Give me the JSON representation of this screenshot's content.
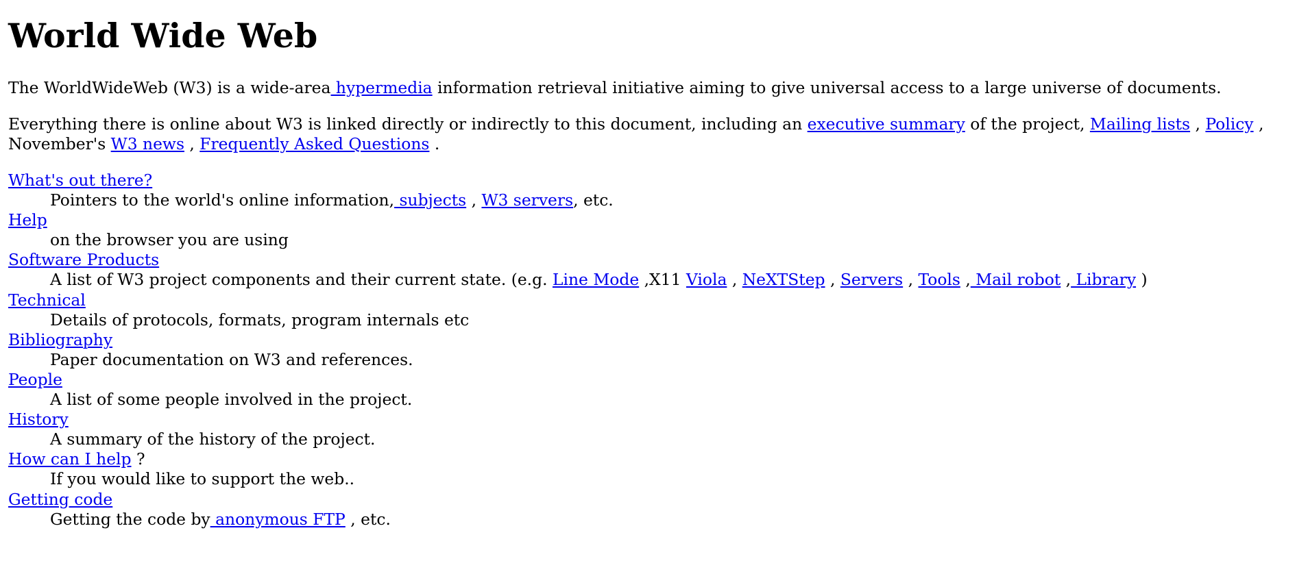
{
  "title": "World Wide Web",
  "intro": {
    "before": "The WorldWideWeb (W3) is a wide-area",
    "link": " hypermedia",
    "after": " information retrieval initiative aiming to give universal access to a large universe of documents."
  },
  "summary": {
    "line1_before": "Everything there is online about W3 is linked directly or indirectly to this document, including an ",
    "executive_summary": "executive summary",
    "mid": " of the project, ",
    "mailing_lists": "Mailing lists",
    "sep1": " , ",
    "policy": "Policy",
    "sep2": " ,",
    "line2_before": "November's ",
    "w3_news": "W3 news",
    "sep3": " , ",
    "faq": "Frequently Asked Questions",
    "end": " ."
  },
  "entries": {
    "whats_out": {
      "term": "What's out there?",
      "desc_before": "Pointers to the world's online information,",
      "subjects": " subjects",
      "sep": " , ",
      "servers": "W3 servers",
      "end": ", etc."
    },
    "help": {
      "term": "Help",
      "desc": "on the browser you are using"
    },
    "software": {
      "term": "Software Products",
      "desc_before": "A list of W3 project components and their current state. (e.g. ",
      "line_mode": "Line Mode",
      "x11": " ,X11 ",
      "viola": "Viola",
      "sep1": " , ",
      "nextstep": "NeXTStep",
      "sep2": " , ",
      "servers": "Servers",
      "sep3": " , ",
      "tools": "Tools",
      "sep4": " ,",
      "mail_robot": " Mail robot",
      "sep5": " ,",
      "library": " Library",
      "end": " )"
    },
    "technical": {
      "term": "Technical",
      "desc": "Details of protocols, formats, program internals etc"
    },
    "bibliography": {
      "term": "Bibliography",
      "desc": "Paper documentation on W3 and references."
    },
    "people": {
      "term": "People",
      "desc": "A list of some people involved in the project."
    },
    "history": {
      "term": "History",
      "desc": "A summary of the history of the project."
    },
    "how_help": {
      "term": "How can I help",
      "term_after": " ?",
      "desc": "If you would like to support the web.."
    },
    "getting_code": {
      "term": "Getting code",
      "desc_before": "Getting the code by",
      "ftp": " anonymous FTP",
      "end": " , etc."
    }
  }
}
